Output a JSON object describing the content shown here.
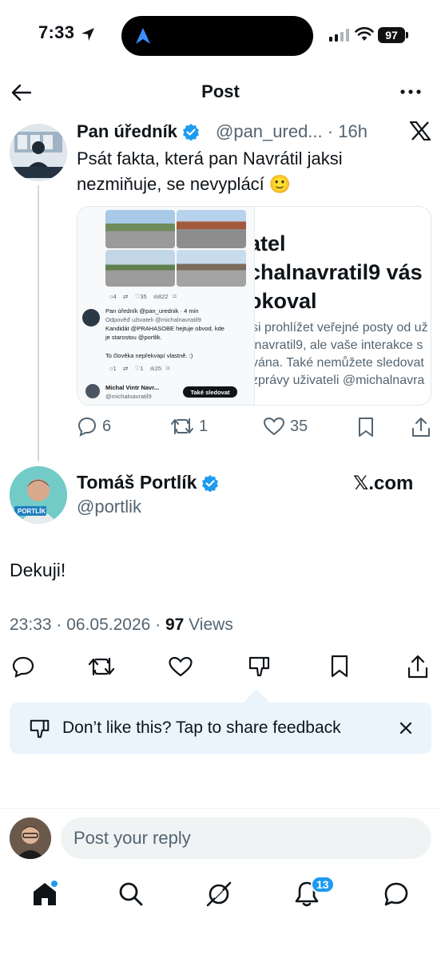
{
  "status_bar": {
    "time": "7:33",
    "battery": "97"
  },
  "header": {
    "title": "Post"
  },
  "quoted_post": {
    "author": "Pan úředník",
    "handle": "@pan_ured...",
    "age": "16h",
    "text_line1": "Psát fakta, která pan Navrátil jaksi",
    "text_line2": "nezmiňuje, se nevyplácí 🙂",
    "card": {
      "heading_line1": "atel",
      "heading_line2": "chalnavratil9 vás",
      "heading_line3": "okoval",
      "body_line1": "si prohlížet veřejné posty od už",
      "body_line2": "lnavratil9, ale vaše interakce s",
      "body_line3": "vána. Také nemůžete sledovat",
      "body_line4": "zprávy uživateli @michalnavra",
      "shot": {
        "row1_replies": "4",
        "row1_likes": "35",
        "row1_views": "822",
        "author": "Pan úředník",
        "handle_age": "@pan_urednik · 4 min",
        "reply_to_prefix": "Odpověď uživateli",
        "reply_to_handle": "@michalnavratil9",
        "line1_prefix": "Kandidát",
        "line1_mention": "@PRAHASOBE",
        "line1_suffix": "hejtuje obvod, kde",
        "line2_prefix": "je starostou",
        "line2_mention": "@portlik.",
        "line3": "To člověka nepřekvapí vlastně. :)",
        "row2_replies": "1",
        "row2_likes": "1",
        "row2_views": "25",
        "profile_name": "Michal Vintr Navr...",
        "profile_handle": "@michalnavratil9",
        "follow_label": "Také sledovat"
      }
    },
    "replies": "6",
    "reposts": "1",
    "likes": "35"
  },
  "main_post": {
    "author": "Tomáš Portlík",
    "handle": "@portlik",
    "source": "𝕏.com",
    "avatar_label": "PORTLÍK",
    "text": "Dekuji!",
    "timestamp": "23:33 · 06.05.2026 · ",
    "views_count": "97",
    "views_label": " Views"
  },
  "feedback": {
    "text": "Don’t like this? Tap to share feedback"
  },
  "reply": {
    "placeholder": "Post your reply"
  },
  "nav": {
    "notifications_badge": "13"
  },
  "colors": {
    "accent": "#1d9bf0",
    "verified": "#1d9bf0",
    "muted": "#536471"
  }
}
